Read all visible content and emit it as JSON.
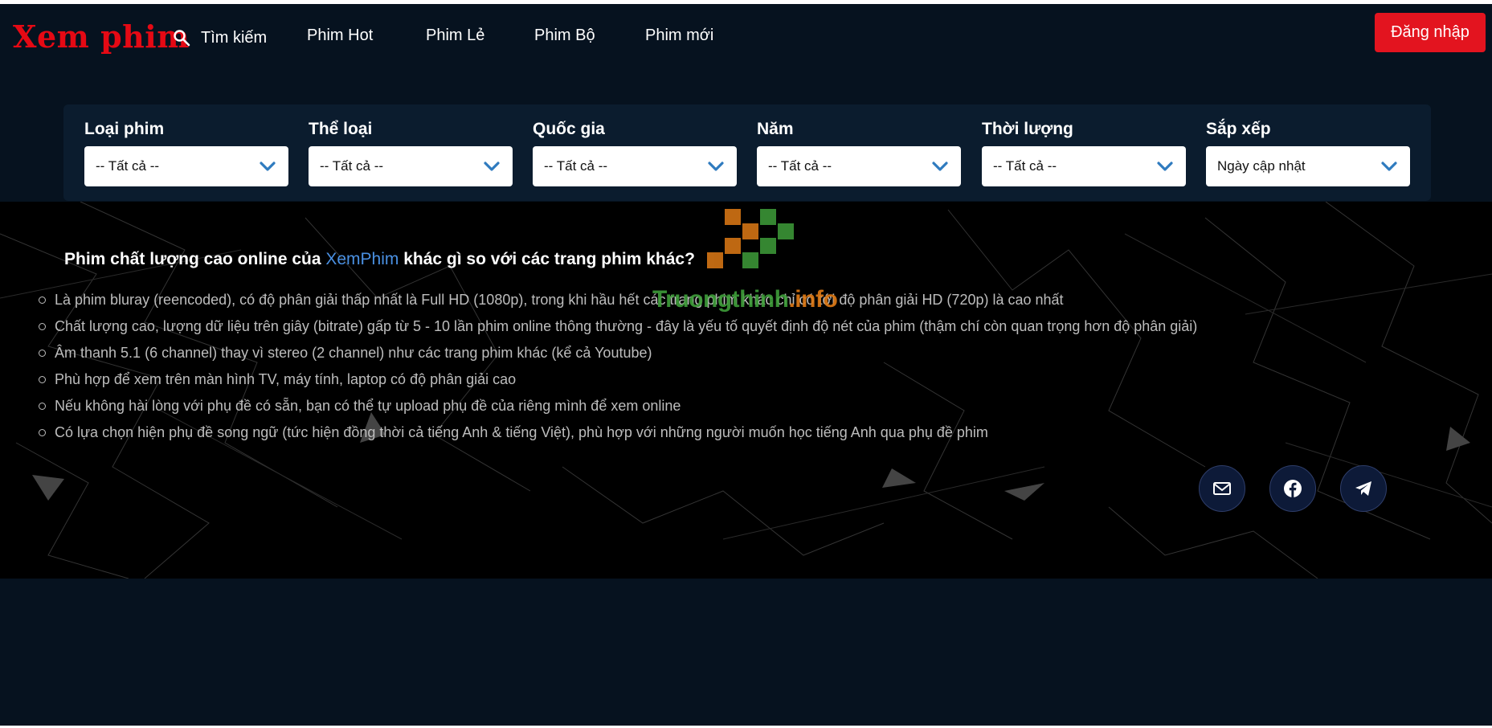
{
  "header": {
    "logo": "Xem phim",
    "search_label": "Tìm kiếm",
    "nav": [
      "Phim Hot",
      "Phim Lẻ",
      "Phim Bộ",
      "Phim mới"
    ],
    "login_label": "Đăng nhập"
  },
  "filters": [
    {
      "label": "Loại phim",
      "value": "-- Tất cả --"
    },
    {
      "label": "Thể loại",
      "value": "-- Tất cả --"
    },
    {
      "label": "Quốc gia",
      "value": "-- Tất cả --"
    },
    {
      "label": "Năm",
      "value": "-- Tất cả --"
    },
    {
      "label": "Thời lượng",
      "value": "-- Tất cả --"
    },
    {
      "label": "Sắp xếp",
      "value": "Ngày cập nhật"
    }
  ],
  "content": {
    "headline_prefix": "Phim chất lượng cao online của ",
    "headline_brand": "XemPhim",
    "headline_suffix": " khác gì so với các trang phim khác?",
    "features": [
      "Là phim bluray (reencoded), có độ phân giải thấp nhất là Full HD (1080p), trong khi hầu hết các trang phim khác chỉ có tới độ phân giải HD (720p) là cao nhất",
      "Chất lượng cao, lượng dữ liệu trên giây (bitrate) gấp từ 5 - 10 lần phim online thông thường - đây là yếu tố quyết định độ nét của phim (thậm chí còn quan trọng hơn độ phân giải)",
      "Âm thanh 5.1 (6 channel) thay vì stereo (2 channel) như các trang phim khác (kể cả Youtube)",
      "Phù hợp để xem trên màn hình TV, máy tính, laptop có độ phân giải cao",
      "Nếu không hài lòng với phụ đề có sẵn, bạn có thể tự upload phụ đề của riêng mình để xem online",
      "Có lựa chọn hiện phụ đề song ngữ (tức hiện đồng thời cả tiếng Anh & tiếng Việt), phù hợp với những người muốn học tiếng Anh qua phụ đề phim"
    ]
  },
  "social": [
    "mail-icon",
    "facebook-icon",
    "telegram-icon"
  ],
  "watermark": {
    "text": "Truongthinh",
    "suffix": ".info"
  },
  "colors": {
    "accent": "#e50914",
    "brand_link": "#4a90e2",
    "background": "#06121f",
    "panel": "#0b1c2e"
  }
}
